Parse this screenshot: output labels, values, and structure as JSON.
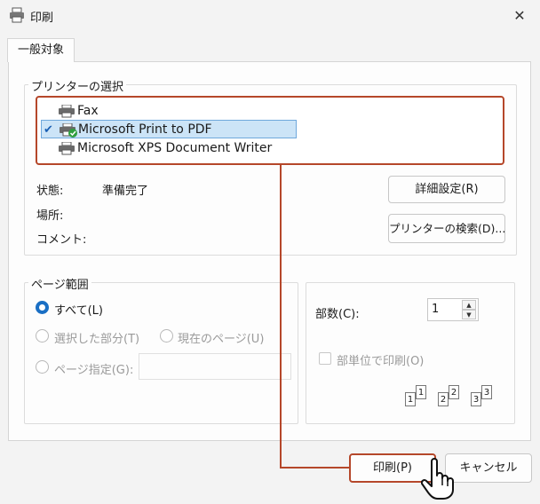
{
  "window": {
    "title": "印刷",
    "close_label": "✕"
  },
  "tabs": [
    {
      "label": "一般対象"
    }
  ],
  "printer_select": {
    "group_label": "プリンターの選択",
    "printers": [
      {
        "name": "Fax",
        "selected": false
      },
      {
        "name": "Microsoft Print to PDF",
        "selected": true
      },
      {
        "name": "Microsoft XPS Document Writer",
        "selected": false
      }
    ],
    "status_label": "状態:",
    "status_value": "準備完了",
    "location_label": "場所:",
    "comment_label": "コメント:",
    "preferences_button": "詳細設定(R)",
    "find_printer_button": "プリンターの検索(D)..."
  },
  "page_range": {
    "group_label": "ページ範囲",
    "all_label": "すべて(L)",
    "selection_label": "選択した部分(T)",
    "current_page_label": "現在のページ(U)",
    "pages_label": "ページ指定(G):",
    "pages_value": ""
  },
  "copies": {
    "label": "部数(C):",
    "value": "1",
    "collate_label": "部単位で印刷(O)",
    "collate_pages": [
      "1",
      "1",
      "2",
      "2",
      "3",
      "3"
    ]
  },
  "footer": {
    "print_button": "印刷(P)",
    "cancel_button": "キャンセル"
  },
  "colors": {
    "accent": "#1a6fc4",
    "highlight": "#b5472a",
    "selection": "#cce4f7"
  }
}
